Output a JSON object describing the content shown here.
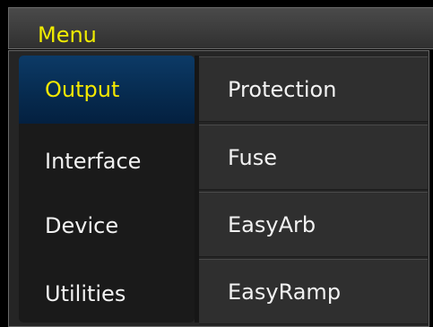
{
  "header": {
    "title": "Menu"
  },
  "menu": {
    "categories": [
      {
        "label": "Output",
        "selected": true
      },
      {
        "label": "Interface",
        "selected": false
      },
      {
        "label": "Device",
        "selected": false
      },
      {
        "label": "Utilities",
        "selected": false
      }
    ],
    "subitems": [
      {
        "label": "Protection"
      },
      {
        "label": "Fuse"
      },
      {
        "label": "EasyArb"
      },
      {
        "label": "EasyRamp"
      }
    ]
  },
  "colors": {
    "title_text": "#f0ec00",
    "selected_text": "#f4e800",
    "selected_bg": "#0c3a66",
    "text": "#f2f2f2"
  }
}
